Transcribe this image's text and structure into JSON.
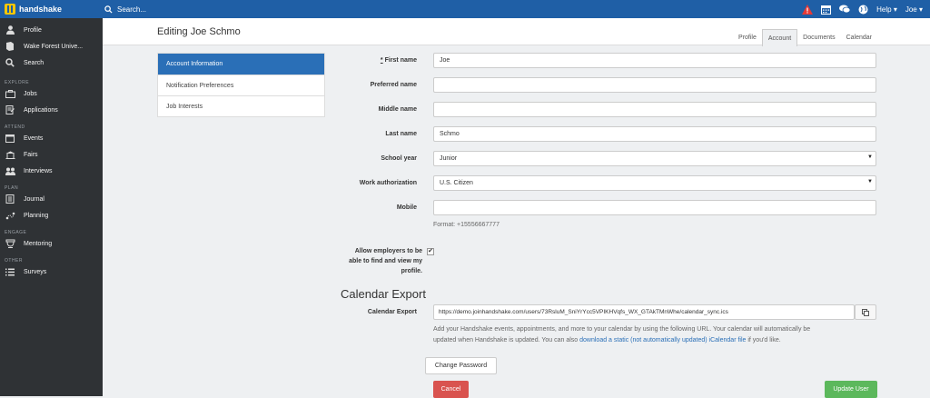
{
  "app": {
    "name": "handshake",
    "search_placeholder": "Search...",
    "help_label": "Help",
    "user_label": "Joe"
  },
  "sidebar": {
    "top": [
      {
        "label": "Profile",
        "icon": "person-icon"
      },
      {
        "label": "Wake Forest Unive...",
        "icon": "school-icon"
      },
      {
        "label": "Search",
        "icon": "search-icon"
      }
    ],
    "sections": [
      {
        "title": "EXPLORE",
        "items": [
          {
            "label": "Jobs",
            "icon": "briefcase-icon"
          },
          {
            "label": "Applications",
            "icon": "applications-icon"
          }
        ]
      },
      {
        "title": "ATTEND",
        "items": [
          {
            "label": "Events",
            "icon": "calendar-icon"
          },
          {
            "label": "Fairs",
            "icon": "fair-icon"
          },
          {
            "label": "Interviews",
            "icon": "interview-icon"
          }
        ]
      },
      {
        "title": "PLAN",
        "items": [
          {
            "label": "Journal",
            "icon": "journal-icon"
          },
          {
            "label": "Planning",
            "icon": "planning-icon"
          }
        ]
      },
      {
        "title": "ENGAGE",
        "items": [
          {
            "label": "Mentoring",
            "icon": "mentoring-icon"
          }
        ]
      },
      {
        "title": "OTHER",
        "items": [
          {
            "label": "Surveys",
            "icon": "list-icon"
          }
        ]
      }
    ]
  },
  "page": {
    "title": "Editing Joe Schmo",
    "tabs": [
      "Profile",
      "Account",
      "Documents",
      "Calendar"
    ],
    "active_tab": "Account"
  },
  "leftnav": {
    "items": [
      "Account Information",
      "Notification Preferences",
      "Job Interests"
    ]
  },
  "form": {
    "required_mark": "*",
    "first_name": {
      "label": "First name",
      "value": "Joe"
    },
    "preferred_name": {
      "label": "Preferred name",
      "value": ""
    },
    "middle_name": {
      "label": "Middle name",
      "value": ""
    },
    "last_name": {
      "label": "Last name",
      "value": "Schmo"
    },
    "school_year": {
      "label": "School year",
      "value": "Junior"
    },
    "work_authorization": {
      "label": "Work authorization",
      "value": "U.S. Citizen"
    },
    "mobile": {
      "label": "Mobile",
      "value": "",
      "help": "Format: +15556667777"
    },
    "allow_employers": {
      "label": "Allow employers to be able to find and view my profile.",
      "checked": true
    }
  },
  "calendar_export": {
    "heading": "Calendar Export",
    "label": "Calendar Export",
    "url": "https://demo.joinhandshake.com/users/73RsluM_SniYrYcc5VPIKHVqfs_WX_GTAkTMnWhe/calendar_sync.ics",
    "help1": "Add your Handshake events, appointments, and more to your calendar by using the following URL. Your calendar will automatically be",
    "help2_pre": "updated when Handshake is updated. You can also ",
    "help2_link": "download a static (not automatically updated) iCalendar file",
    "help2_post": " if you'd like."
  },
  "buttons": {
    "change_password": "Change Password",
    "cancel": "Cancel",
    "update_user": "Update User"
  },
  "colors": {
    "topbar": "#1f5fa6",
    "sidebar": "#2f3235",
    "active_nav": "#2a6fb7",
    "cancel": "#d9534f",
    "update": "#5cb85c",
    "alert": "#e53935"
  }
}
